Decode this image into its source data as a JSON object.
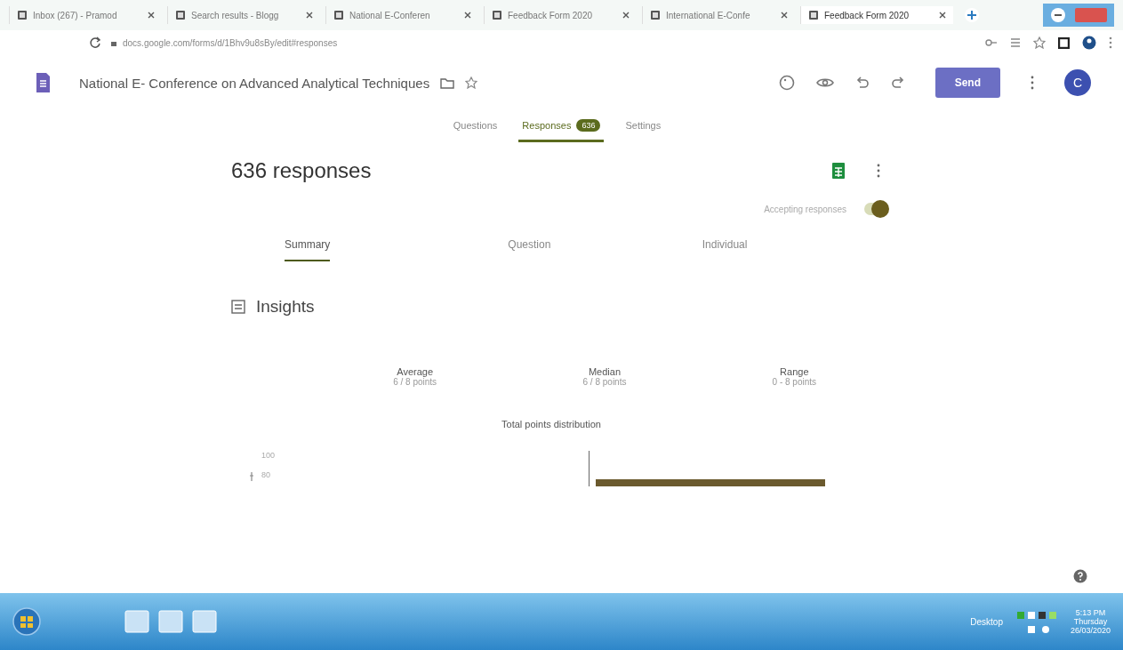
{
  "browser": {
    "tabs": [
      {
        "title": "Inbox (267) - Pramod",
        "selected": false
      },
      {
        "title": "Search results - Blogg",
        "selected": false
      },
      {
        "title": "National E-Conferen",
        "selected": false
      },
      {
        "title": "Feedback Form 2020",
        "selected": false
      },
      {
        "title": "International E-Confe",
        "selected": false
      },
      {
        "title": "Feedback Form 2020",
        "selected": true
      }
    ],
    "url": "docs.google.com/forms/d/1Bhv9u8sBy/edit#responses"
  },
  "form": {
    "title": "National E- Conference on Advanced Analytical Techniques",
    "send_label": "Send",
    "avatar": "C"
  },
  "tabs": [
    {
      "label": "Questions",
      "selected": false
    },
    {
      "label": "Responses",
      "badge": "636",
      "selected": true
    },
    {
      "label": "Settings",
      "selected": false
    }
  ],
  "responses": {
    "count": "636 responses",
    "accepting_label": "Accepting responses",
    "accepting": true
  },
  "view_tabs": [
    {
      "label": "Summary",
      "selected": true
    },
    {
      "label": "Question",
      "selected": false
    },
    {
      "label": "Individual",
      "selected": false
    }
  ],
  "insights": {
    "title": "Insights",
    "stats": [
      {
        "label": "Average",
        "value": "6 / 8 points"
      },
      {
        "label": "Median",
        "value": "6 / 8 points"
      },
      {
        "label": "Range",
        "value": "0 - 8 points"
      }
    ],
    "chart_title": "Total points distribution",
    "ticks": [
      "100",
      "80"
    ]
  },
  "taskbar": {
    "desktop": "Desktop",
    "time": "5:13 PM",
    "day": "Thursday",
    "date": "26/03/2020"
  }
}
